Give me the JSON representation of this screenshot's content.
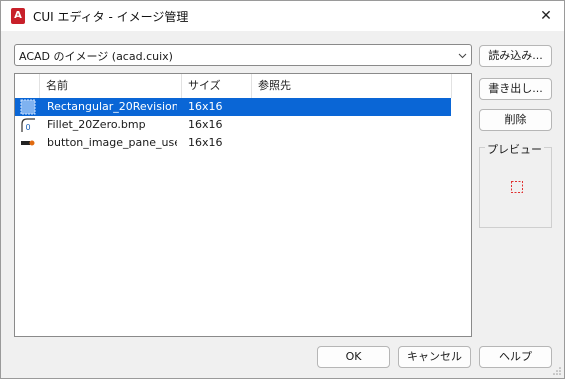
{
  "window": {
    "app_icon_letter": "A",
    "title": "CUI エディタ - イメージ管理",
    "close_glyph": "✕"
  },
  "source_select": {
    "value": "ACAD のイメージ (acad.cuix)"
  },
  "side_buttons": {
    "load": "読み込み...",
    "export": "書き出し...",
    "delete": "削除"
  },
  "list": {
    "columns": {
      "name": "名前",
      "size": "サイズ",
      "ref": "参照先"
    },
    "rows": [
      {
        "name": "Rectangular_20Revision...",
        "size": "16x16",
        "ref": "",
        "icon": "rectangle-revision-icon",
        "selected": true
      },
      {
        "name": "Fillet_20Zero.bmp",
        "size": "16x16",
        "ref": "",
        "icon": "fillet-zero-icon",
        "selected": false
      },
      {
        "name": "button_image_pane_use...",
        "size": "16x16",
        "ref": "",
        "icon": "button-image-icon",
        "selected": false
      }
    ]
  },
  "preview": {
    "label": "プレビュー"
  },
  "footer": {
    "ok": "OK",
    "cancel": "キャンセル",
    "help": "ヘルプ"
  },
  "colors": {
    "accent": "#0a66d6",
    "app_icon": "#c8202a",
    "preview_shape": "#e03030"
  }
}
